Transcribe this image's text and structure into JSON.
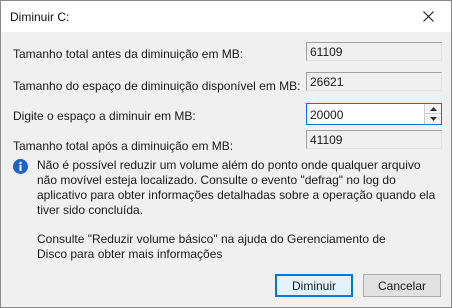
{
  "window": {
    "title": "Diminuir C:"
  },
  "fields": {
    "total_before_label": "Tamanho total antes da diminuição em MB:",
    "total_before_value": "61109",
    "available_label": "Tamanho do espaço de diminuição disponível em MB:",
    "available_value": "26621",
    "shrink_label": "Digite o espaço a diminuir em MB:",
    "shrink_value": "20000",
    "total_after_label": "Tamanho total após a diminuição em MB:",
    "total_after_value": "41109"
  },
  "info": {
    "text": "Não é possível reduzir um volume além do ponto onde qualquer arquivo não movível esteja localizado. Consulte o evento \"defrag\" no log do aplicativo para obter informações detalhadas sobre a operação quando ela tiver sido concluída."
  },
  "help": {
    "text": "Consulte \"Reduzir volume básico\" na ajuda do Gerenciamento de Disco para obter mais informações"
  },
  "buttons": {
    "shrink_label": "Diminuir",
    "cancel_label": "Cancelar"
  },
  "icons": {
    "close": "close-icon",
    "info": "info-icon",
    "spin_up": "chevron-up-icon",
    "spin_down": "chevron-down-icon"
  },
  "colors": {
    "focus_accent": "#0078d7",
    "info_blue": "#1e64c8",
    "dialog_bg": "#f0f0f0"
  }
}
